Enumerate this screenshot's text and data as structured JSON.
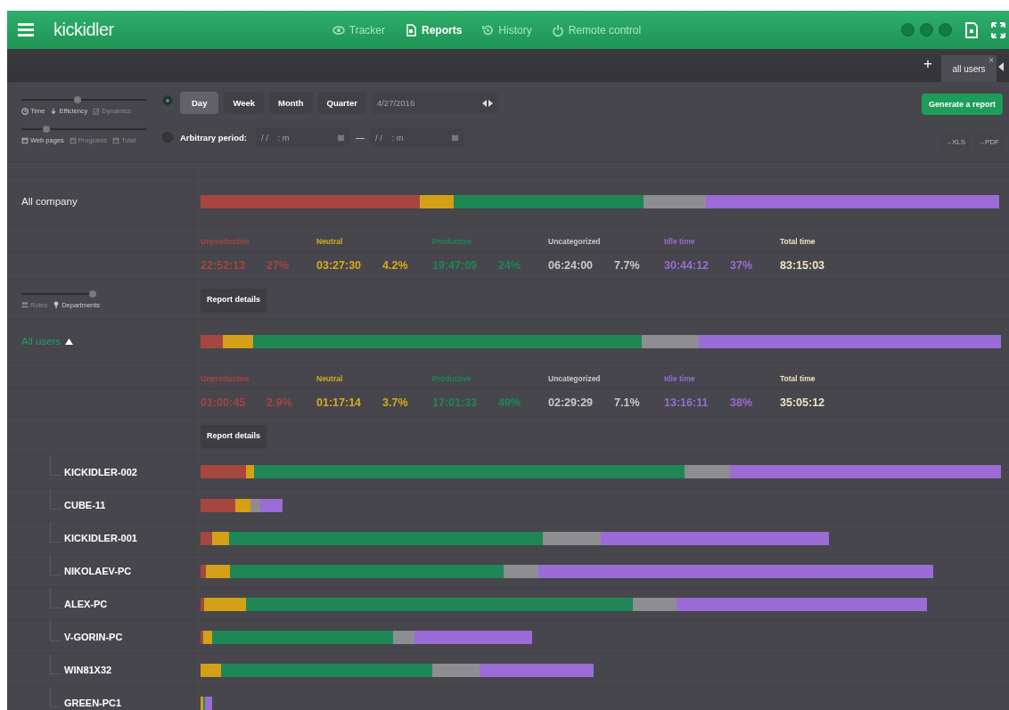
{
  "header": {
    "logo": "kickidler",
    "nav": [
      {
        "label": "Tracker",
        "selected": false
      },
      {
        "label": "Reports",
        "selected": true
      },
      {
        "label": "History",
        "selected": false
      },
      {
        "label": "Remote control",
        "selected": false
      }
    ]
  },
  "tab_bar": {
    "add": "+",
    "tabs": [
      {
        "label": "all users",
        "close": "×",
        "selected": true
      }
    ]
  },
  "toolbar": {
    "metric_slider": {
      "level": 0.45,
      "options": [
        {
          "label": "Time",
          "selected": true
        },
        {
          "label": "Efficiency",
          "selected": true
        },
        {
          "label": "Dynamics",
          "selected": false
        }
      ]
    },
    "source_slider": {
      "level": 0.2,
      "options": [
        {
          "label": "Web pages",
          "selected": true
        },
        {
          "label": "Programs",
          "selected": false
        },
        {
          "label": "Total",
          "selected": false
        }
      ]
    },
    "period_mode": [
      {
        "selected": true
      },
      {
        "selected": false
      }
    ],
    "periods": [
      {
        "label": "Day",
        "selected": true
      },
      {
        "label": "Week",
        "selected": false
      },
      {
        "label": "Month",
        "selected": false
      },
      {
        "label": "Quarter",
        "selected": false
      }
    ],
    "date": {
      "value": "4/27/2016"
    },
    "arbitrary": {
      "label": "Arbitrary period:",
      "from": {
        "placeholder": "/ /    : m"
      },
      "dash": "—",
      "to": {
        "placeholder": "/ /    : m"
      }
    },
    "generate_button": "Generate a report",
    "exports": [
      "→XLS",
      "→PDF"
    ]
  },
  "group_switch": {
    "level": 1,
    "options": [
      {
        "label": "Roles",
        "selected": false
      },
      {
        "label": "Departments",
        "selected": true
      }
    ]
  },
  "groups": [
    {
      "name": "All company",
      "kind": "company",
      "details_button": "Report details",
      "bar": [
        {
          "color": "#a5463f"
        },
        {
          "color": "#d4a017"
        },
        {
          "color": "#1e8755"
        },
        {
          "color": "#8e8e92"
        },
        {
          "color": "#9b6bd6"
        }
      ],
      "stats": [
        {
          "label": "Unproductive",
          "value": "22:52:13",
          "percent": "27%",
          "color": "#a5463f"
        },
        {
          "label": "Neutral",
          "value": "03:27:30",
          "percent": "4.2%",
          "color": "#d8aa1c"
        },
        {
          "label": "Productive",
          "value": "19:47:09",
          "percent": "24%",
          "color": "#1e8755"
        },
        {
          "label": "Uncategorized",
          "value": "06:24:00",
          "percent": "7.7%",
          "color": "#c8c8cc"
        },
        {
          "label": "Idle time",
          "value": "30:44:12",
          "percent": "37%",
          "color": "#9b6bd6"
        },
        {
          "label": "Total time",
          "value": "83:15:03",
          "color": "#f2e2c0"
        }
      ]
    },
    {
      "name": "All users",
      "kind": "users",
      "expanded": true,
      "details_button": "Report details",
      "bar": [
        {
          "color": "#a5463f"
        },
        {
          "color": "#d4a017"
        },
        {
          "color": "#1e8755"
        },
        {
          "color": "#8e8e92"
        },
        {
          "color": "#9b6bd6"
        }
      ],
      "stats": [
        {
          "label": "Unproductive",
          "value": "01:00:45",
          "percent": "2.9%",
          "color": "#a5463f"
        },
        {
          "label": "Neutral",
          "value": "01:17:14",
          "percent": "3.7%",
          "color": "#d8aa1c"
        },
        {
          "label": "Productive",
          "value": "17:01:33",
          "percent": "49%",
          "color": "#1e8755"
        },
        {
          "label": "Uncategorized",
          "value": "02:29:29",
          "percent": "7.1%",
          "color": "#c8c8cc"
        },
        {
          "label": "Idle time",
          "value": "13:16:11",
          "percent": "38%",
          "color": "#9b6bd6"
        },
        {
          "label": "Total time",
          "value": "35:05:12",
          "color": "#f2e2c0"
        }
      ],
      "children": [
        {
          "name": "KICKIDLER-002",
          "bar": [
            {
              "color": "#a5463f"
            },
            {
              "color": "#d4a017"
            },
            {
              "color": "#1e8755"
            },
            {
              "color": "#8e8e92"
            },
            {
              "color": "#9b6bd6"
            }
          ]
        },
        {
          "name": "CUBE-11",
          "bar": [
            {
              "color": "#a5463f"
            },
            {
              "color": "#d4a017"
            },
            {
              "color": "#8e8e92"
            },
            {
              "color": "#9b6bd6"
            }
          ]
        },
        {
          "name": "KICKIDLER-001",
          "bar": [
            {
              "color": "#a5463f"
            },
            {
              "color": "#d4a017"
            },
            {
              "color": "#1e8755"
            },
            {
              "color": "#8e8e92"
            },
            {
              "color": "#9b6bd6"
            }
          ]
        },
        {
          "name": "NIKOLAEV-PC",
          "bar": [
            {
              "color": "#a5463f"
            },
            {
              "color": "#d4a017"
            },
            {
              "color": "#1e8755"
            },
            {
              "color": "#8e8e92"
            },
            {
              "color": "#9b6bd6"
            }
          ]
        },
        {
          "name": "ALEX-PC",
          "bar": [
            {
              "color": "#a5463f"
            },
            {
              "color": "#d4a017"
            },
            {
              "color": "#1e8755"
            },
            {
              "color": "#8e8e92"
            },
            {
              "color": "#9b6bd6"
            }
          ]
        },
        {
          "name": "V-GORIN-PC",
          "bar": [
            {
              "color": "#a5463f"
            },
            {
              "color": "#d4a017"
            },
            {
              "color": "#1e8755"
            },
            {
              "color": "#8e8e92"
            },
            {
              "color": "#9b6bd6"
            }
          ]
        },
        {
          "name": "WIN81X32",
          "bar": [
            {
              "color": "#d4a017"
            },
            {
              "color": "#1e8755"
            },
            {
              "color": "#8e8e92"
            },
            {
              "color": "#9b6bd6"
            }
          ]
        },
        {
          "name": "GREEN-PC1",
          "bar": [
            {
              "color": "#d4a017"
            },
            {
              "color": "#1e8755"
            },
            {
              "color": "#9b6bd6"
            }
          ]
        }
      ]
    }
  ]
}
